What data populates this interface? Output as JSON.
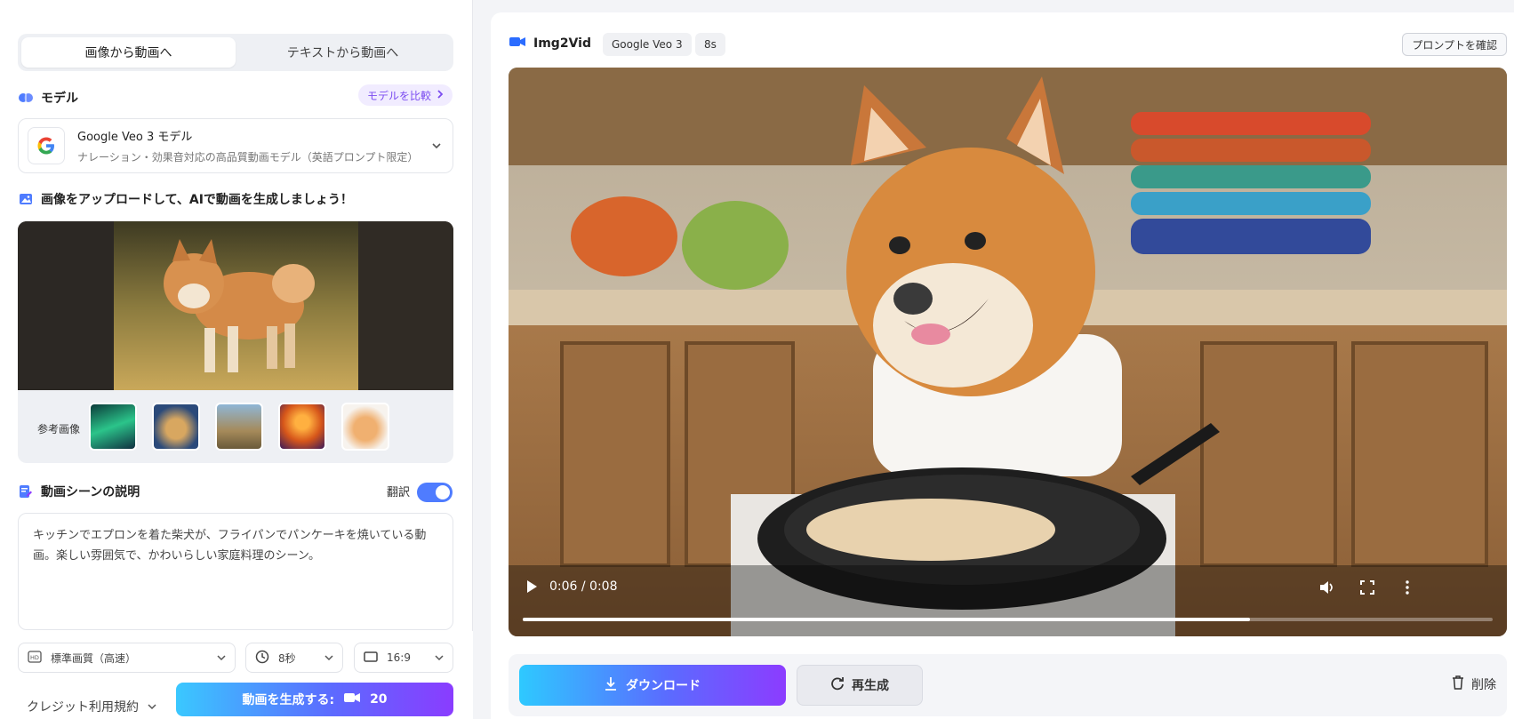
{
  "left": {
    "tabs": [
      {
        "label": "画像から動画へ",
        "active": true
      },
      {
        "label": "テキストから動画へ",
        "active": false
      }
    ],
    "model_section": {
      "title": "モデル",
      "compare_label": "モデルを比較",
      "model_name": "Google Veo 3 モデル",
      "model_desc": "ナレーション・効果音対応の高品質動画モデル（英語プロンプト限定）"
    },
    "upload_section": {
      "title": "画像をアップロードして、AIで動画を生成しましょう！",
      "ref_label": "参考画像"
    },
    "description_section": {
      "title": "動画シーンの説明",
      "translate_label": "翻訳",
      "text": "キッチンでエプロンを着た柴犬が、フライパンでパンケーキを焼いている動画。楽しい雰囲気で、かわいらしい家庭料理のシーン。"
    },
    "options": {
      "quality": "標準画質（高速）",
      "duration": "8秒",
      "ratio": "16:9"
    },
    "credit_terms": "クレジット利用規約",
    "generate_label": "動画を生成する:",
    "generate_cost": "20"
  },
  "right": {
    "brand": "Img2Vid",
    "chips": {
      "model": "Google Veo 3",
      "duration": "8s"
    },
    "prompt_button": "プロンプトを確認",
    "player": {
      "time": "0:06 / 0:08",
      "progress": 0.75
    },
    "download_label": "ダウンロード",
    "regenerate_label": "再生成",
    "delete_label": "削除"
  },
  "colors": {
    "accent_purple": "#7b4bf0",
    "toggle_blue": "#4f7cff",
    "gradient_start": "#2ec9ff",
    "gradient_end": "#8c3cff"
  }
}
